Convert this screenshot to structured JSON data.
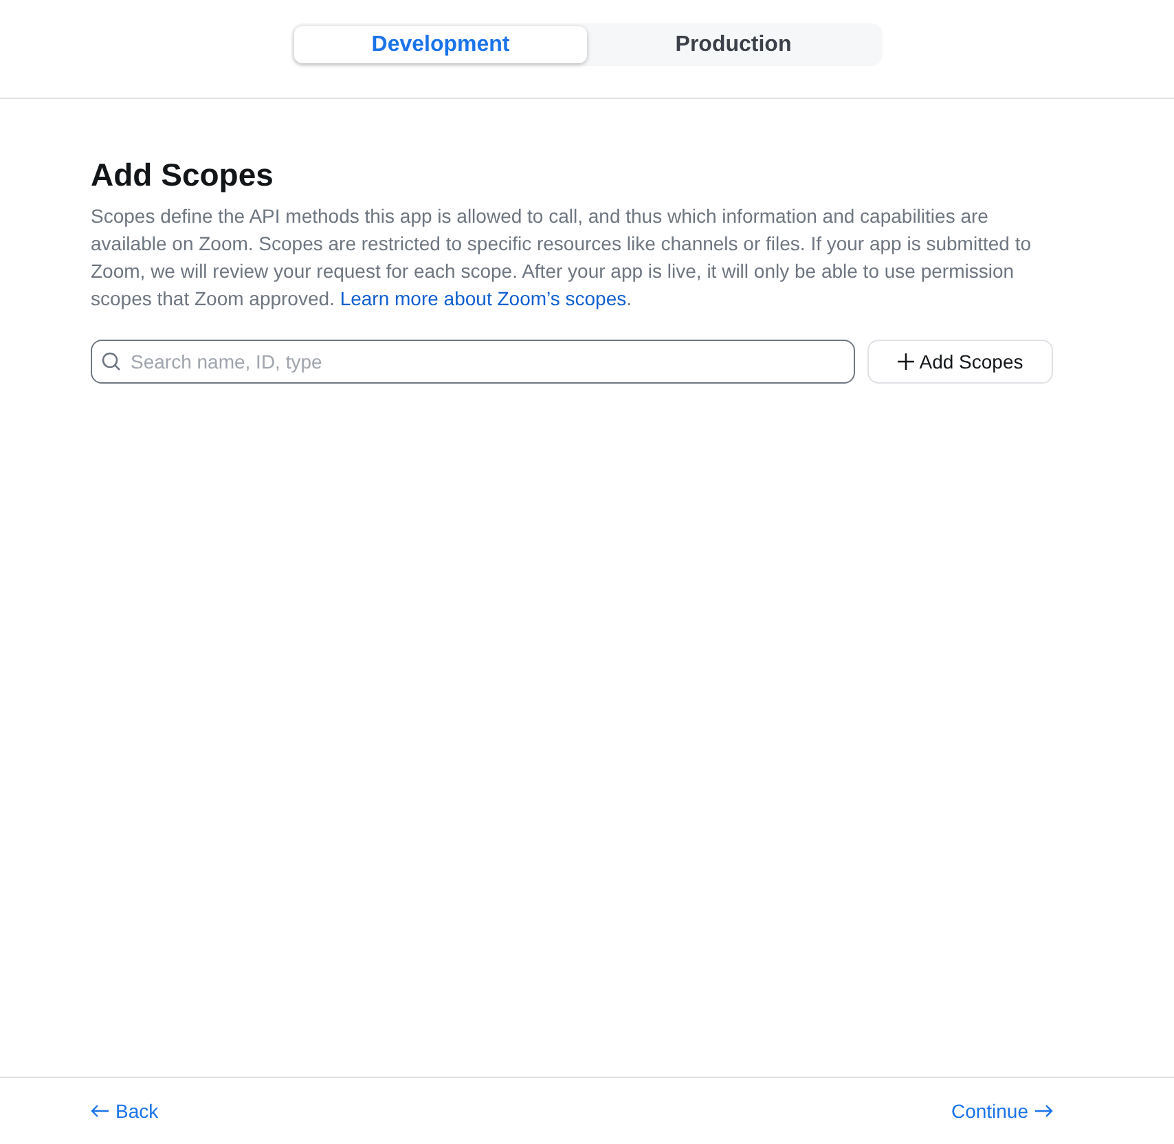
{
  "tabs": [
    {
      "label": "Development",
      "selected": true
    },
    {
      "label": "Production",
      "selected": false
    }
  ],
  "section": {
    "title": "Add Scopes",
    "description": "Scopes define the API methods this app is allowed to call, and thus which information and capabilities are available on Zoom. Scopes are restricted to specific resources like channels or files. If your app is submitted to Zoom, we will review your request for each scope. After your app is live, it will only be able to use permission scopes that Zoom approved.",
    "link": "Learn more about Zoom’s scopes",
    "after_link": "."
  },
  "search": {
    "placeholder": "Search name, ID, type"
  },
  "add_button": {
    "label": "Add Scopes"
  },
  "footer": {
    "back": "Back",
    "continue": "Continue"
  }
}
